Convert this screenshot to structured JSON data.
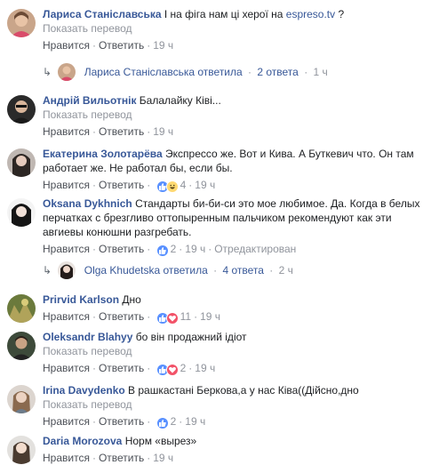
{
  "ui": {
    "like": "Нравится",
    "reply": "Ответить",
    "translate": "Показать перевод",
    "sep": "·",
    "arrow": "↳"
  },
  "comments": [
    {
      "author": "Лариса Станіславська",
      "text": "І на фіга нам ці херої на",
      "link": "espreso.tv",
      "text_after": " ?",
      "time": "19 ч",
      "reactions": null,
      "edited": null
    },
    {
      "author": "Андрій Вильотнік",
      "text": "Балалайку Ківі...",
      "time": "19 ч",
      "reactions": null
    },
    {
      "author": "Екатерина Золотарёва",
      "text": "Экспрессо же. Вот и Кива. А Буткевич что. Он там работает же. Не работал бы, если бы.",
      "time": "19 ч",
      "reactions": "4"
    },
    {
      "author": "Oksana Dykhnich",
      "text": "Стандарты би-би-си это мое любимое. Да. Когда в белых перчатках с брезгливо оттопыренным пальчиком рекомендуют как эти авгиевы конюшни разгребать.",
      "time": "19 ч",
      "reactions": "2",
      "edited": "Отредактирован"
    },
    {
      "author": "Prirvid Karlson",
      "text": "Дно",
      "time": "19 ч",
      "reactions": "11"
    },
    {
      "author": "Oleksandr Blahyy",
      "text": "бо він продажний ідіот",
      "time": "19 ч",
      "reactions": "2"
    },
    {
      "author": "Irina Davydenko",
      "text": "В рашкастані Беркова,а у нас Ківа((Дійсно,дно",
      "time": "19 ч",
      "reactions": "2"
    },
    {
      "author": "Daria Morozova",
      "text": "Норм «вырез»",
      "time": "19 ч",
      "reactions": null
    }
  ],
  "reply_threads": [
    {
      "author": "Лариса Станіславська",
      "verb": "ответила",
      "count": "2 ответа",
      "time": "1 ч"
    },
    {
      "author": "Olga Khudetska",
      "verb": "ответила",
      "count": "4 ответа",
      "time": "2 ч"
    }
  ],
  "colors": {
    "link": "#385898",
    "meta": "#90949c",
    "like": "#5890ff",
    "love": "#f25268",
    "haha": "#ffd972"
  }
}
